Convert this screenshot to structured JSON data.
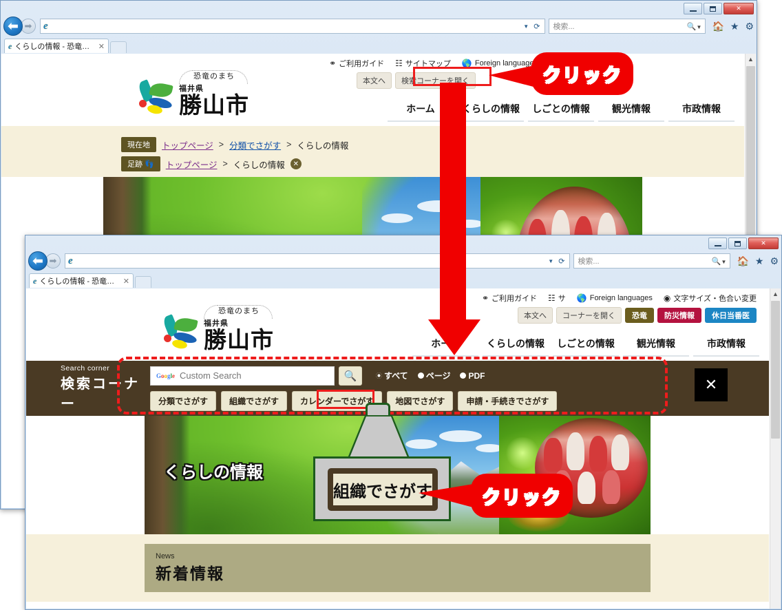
{
  "window1": {
    "tab_title": "くらしの情報 - 恐竜のま...",
    "address_value": "",
    "search_placeholder": "検索...",
    "utility": [
      {
        "label": "ご利用ガイド",
        "icon": "guide-shield-icon"
      },
      {
        "label": "サイトマップ",
        "icon": "sitemap-icon"
      },
      {
        "label": "Foreign languages",
        "icon": "globe-icon"
      }
    ],
    "mini_buttons": [
      "本文へ",
      "検索コーナーを開く"
    ],
    "logo": {
      "bubble": "恐竜のまち",
      "pref": "福井県",
      "city": "勝山市"
    },
    "gnav": [
      "ホーム",
      "くらしの情報",
      "しごとの情報",
      "観光情報",
      "市政情報"
    ],
    "breadcrumb_current": {
      "tag": "現在地",
      "items": [
        "トップページ",
        ">",
        "分類でさがす",
        ">",
        "くらしの情報"
      ]
    },
    "breadcrumb_history": {
      "tag": "足跡",
      "items": [
        "トップページ",
        ">",
        "くらしの情報"
      ],
      "close": "✕"
    }
  },
  "window2": {
    "tab_title": "くらしの情報 - 恐竜のま...",
    "address_value": "",
    "search_placeholder": "検索...",
    "utility": [
      {
        "label": "ご利用ガイド",
        "icon": "guide-shield-icon"
      },
      {
        "label": "サ",
        "icon": "sitemap-icon"
      },
      {
        "label": "Foreign languages",
        "icon": "globe-icon"
      },
      {
        "label": "文字サイズ・色合い変更",
        "icon": "contrast-icon"
      }
    ],
    "mini_buttons": [
      "本文へ",
      "コーナーを開く"
    ],
    "pills": [
      {
        "label": "恐竜",
        "color": "#6b5d1e"
      },
      {
        "label": "防災情報",
        "color": "#b4123f"
      },
      {
        "label": "休日当番医",
        "color": "#1c86c4"
      }
    ],
    "logo": {
      "bubble": "恐竜のまち",
      "pref": "福井県",
      "city": "勝山市"
    },
    "gnav": [
      "ホーム",
      "くらしの情報",
      "しごとの情報",
      "観光情報",
      "市政情報"
    ],
    "search_corner": {
      "label_en": "Search corner",
      "label_jp": "検索コーナー",
      "google_mark": "Google",
      "input_placeholder": "Custom Search",
      "search_button_icon": "magnifier-icon",
      "radios": [
        {
          "label": "すべて",
          "selected": true
        },
        {
          "label": "ページ",
          "selected": false
        },
        {
          "label": "PDF",
          "selected": false
        }
      ],
      "tabs": [
        "分類でさがす",
        "組織でさがす",
        "カレンダーでさがす",
        "地図でさがす",
        "申請・手続きでさがす"
      ],
      "highlighted_tab": "組織でさがす",
      "close_label": "✕"
    },
    "hero_title": "くらしの情報",
    "news": {
      "en": "News",
      "jp": "新着情報"
    }
  },
  "annotations": {
    "balloon_top": "クリック",
    "balloon_bottom": "クリック",
    "magnified_button": "組織でさがす",
    "accent_red": "#ee1c1c",
    "arrow_color": "#f00000"
  }
}
